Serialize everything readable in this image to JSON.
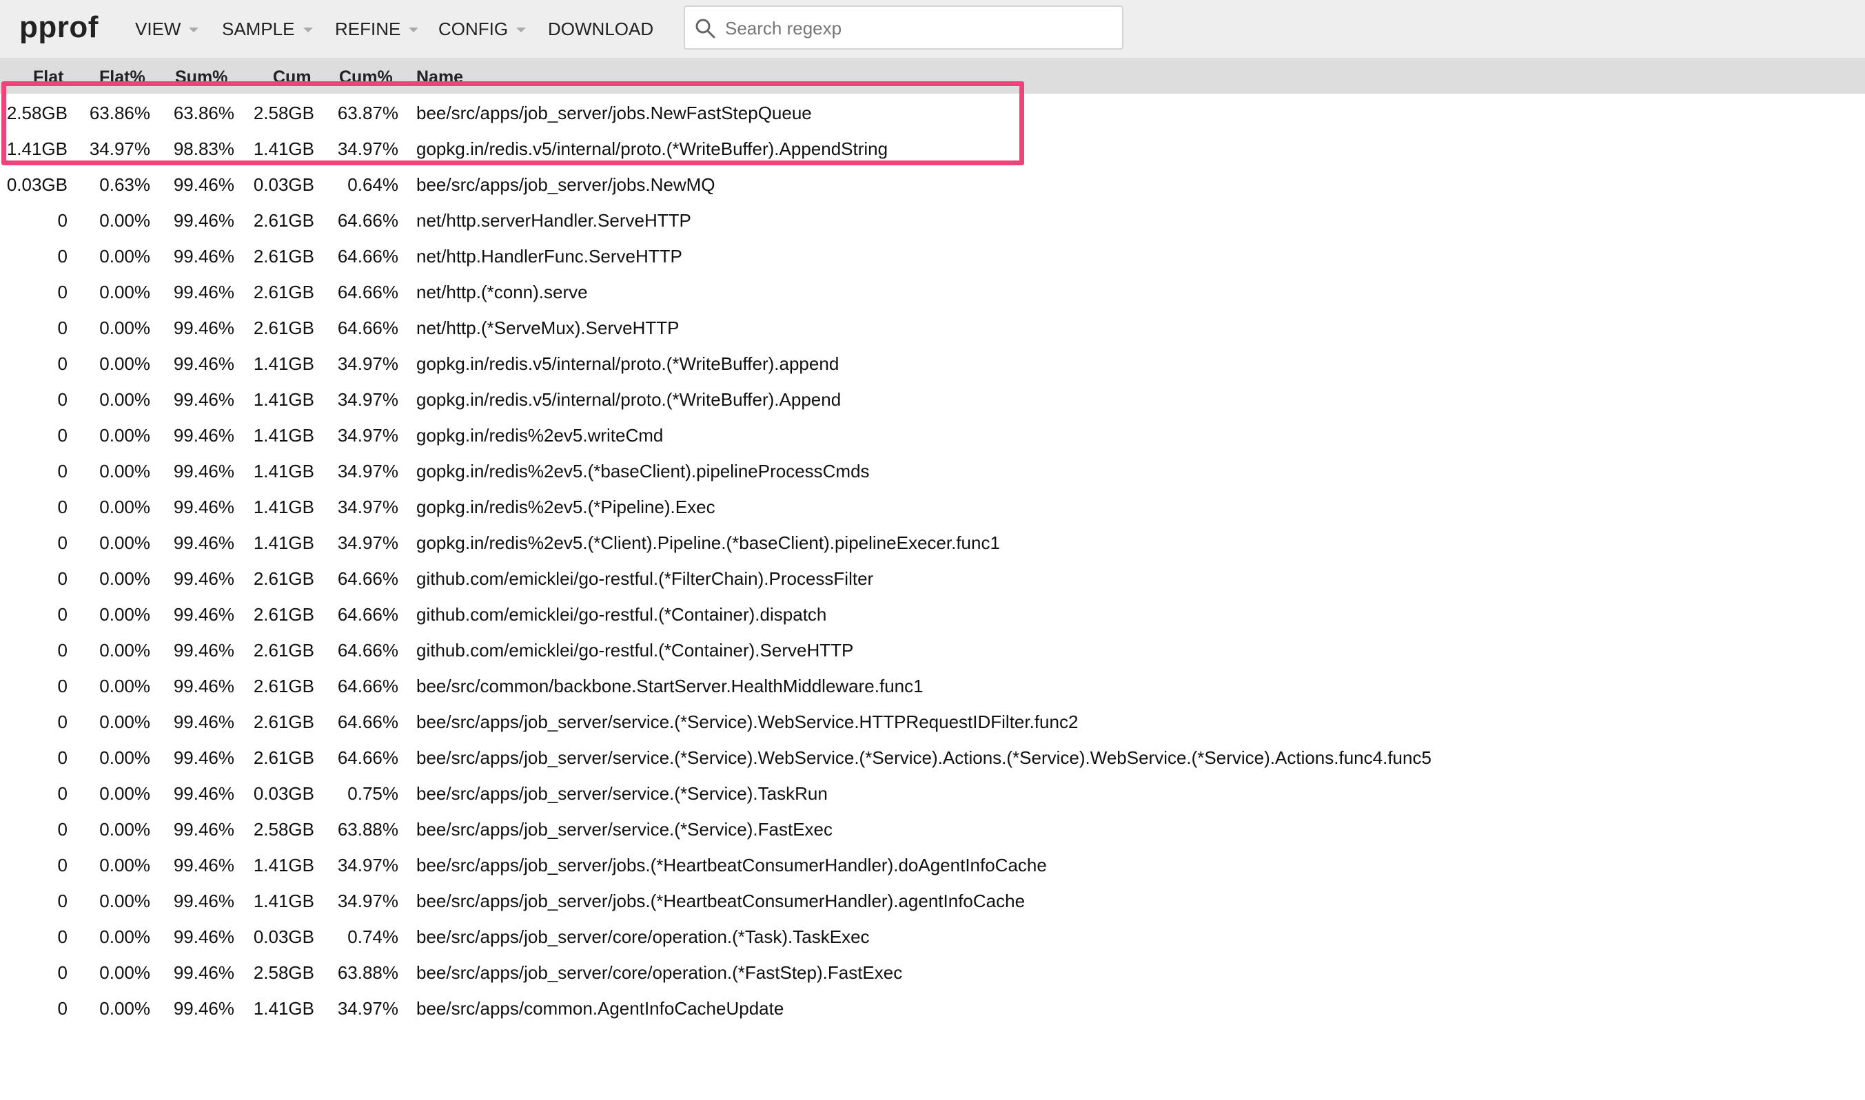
{
  "app": {
    "logo": "pprof"
  },
  "menu": {
    "items": [
      {
        "label": "VIEW",
        "has_caret": true
      },
      {
        "label": "SAMPLE",
        "has_caret": true
      },
      {
        "label": "REFINE",
        "has_caret": true
      },
      {
        "label": "CONFIG",
        "has_caret": true
      },
      {
        "label": "DOWNLOAD",
        "has_caret": false
      }
    ]
  },
  "search": {
    "placeholder": "Search regexp",
    "value": "",
    "icon": "search-icon"
  },
  "table": {
    "columns": [
      "Flat",
      "Flat%",
      "Sum%",
      "Cum",
      "Cum%",
      "Name"
    ],
    "rows": [
      {
        "flat": "2.58GB",
        "flat_pct": "63.86%",
        "sum_pct": "63.86%",
        "cum": "2.58GB",
        "cum_pct": "63.87%",
        "name": "bee/src/apps/job_server/jobs.NewFastStepQueue"
      },
      {
        "flat": "1.41GB",
        "flat_pct": "34.97%",
        "sum_pct": "98.83%",
        "cum": "1.41GB",
        "cum_pct": "34.97%",
        "name": "gopkg.in/redis.v5/internal/proto.(*WriteBuffer).AppendString"
      },
      {
        "flat": "0.03GB",
        "flat_pct": "0.63%",
        "sum_pct": "99.46%",
        "cum": "0.03GB",
        "cum_pct": "0.64%",
        "name": "bee/src/apps/job_server/jobs.NewMQ"
      },
      {
        "flat": "0",
        "flat_pct": "0.00%",
        "sum_pct": "99.46%",
        "cum": "2.61GB",
        "cum_pct": "64.66%",
        "name": "net/http.serverHandler.ServeHTTP"
      },
      {
        "flat": "0",
        "flat_pct": "0.00%",
        "sum_pct": "99.46%",
        "cum": "2.61GB",
        "cum_pct": "64.66%",
        "name": "net/http.HandlerFunc.ServeHTTP"
      },
      {
        "flat": "0",
        "flat_pct": "0.00%",
        "sum_pct": "99.46%",
        "cum": "2.61GB",
        "cum_pct": "64.66%",
        "name": "net/http.(*conn).serve"
      },
      {
        "flat": "0",
        "flat_pct": "0.00%",
        "sum_pct": "99.46%",
        "cum": "2.61GB",
        "cum_pct": "64.66%",
        "name": "net/http.(*ServeMux).ServeHTTP"
      },
      {
        "flat": "0",
        "flat_pct": "0.00%",
        "sum_pct": "99.46%",
        "cum": "1.41GB",
        "cum_pct": "34.97%",
        "name": "gopkg.in/redis.v5/internal/proto.(*WriteBuffer).append"
      },
      {
        "flat": "0",
        "flat_pct": "0.00%",
        "sum_pct": "99.46%",
        "cum": "1.41GB",
        "cum_pct": "34.97%",
        "name": "gopkg.in/redis.v5/internal/proto.(*WriteBuffer).Append"
      },
      {
        "flat": "0",
        "flat_pct": "0.00%",
        "sum_pct": "99.46%",
        "cum": "1.41GB",
        "cum_pct": "34.97%",
        "name": "gopkg.in/redis%2ev5.writeCmd"
      },
      {
        "flat": "0",
        "flat_pct": "0.00%",
        "sum_pct": "99.46%",
        "cum": "1.41GB",
        "cum_pct": "34.97%",
        "name": "gopkg.in/redis%2ev5.(*baseClient).pipelineProcessCmds"
      },
      {
        "flat": "0",
        "flat_pct": "0.00%",
        "sum_pct": "99.46%",
        "cum": "1.41GB",
        "cum_pct": "34.97%",
        "name": "gopkg.in/redis%2ev5.(*Pipeline).Exec"
      },
      {
        "flat": "0",
        "flat_pct": "0.00%",
        "sum_pct": "99.46%",
        "cum": "1.41GB",
        "cum_pct": "34.97%",
        "name": "gopkg.in/redis%2ev5.(*Client).Pipeline.(*baseClient).pipelineExecer.func1"
      },
      {
        "flat": "0",
        "flat_pct": "0.00%",
        "sum_pct": "99.46%",
        "cum": "2.61GB",
        "cum_pct": "64.66%",
        "name": "github.com/emicklei/go-restful.(*FilterChain).ProcessFilter"
      },
      {
        "flat": "0",
        "flat_pct": "0.00%",
        "sum_pct": "99.46%",
        "cum": "2.61GB",
        "cum_pct": "64.66%",
        "name": "github.com/emicklei/go-restful.(*Container).dispatch"
      },
      {
        "flat": "0",
        "flat_pct": "0.00%",
        "sum_pct": "99.46%",
        "cum": "2.61GB",
        "cum_pct": "64.66%",
        "name": "github.com/emicklei/go-restful.(*Container).ServeHTTP"
      },
      {
        "flat": "0",
        "flat_pct": "0.00%",
        "sum_pct": "99.46%",
        "cum": "2.61GB",
        "cum_pct": "64.66%",
        "name": "bee/src/common/backbone.StartServer.HealthMiddleware.func1"
      },
      {
        "flat": "0",
        "flat_pct": "0.00%",
        "sum_pct": "99.46%",
        "cum": "2.61GB",
        "cum_pct": "64.66%",
        "name": "bee/src/apps/job_server/service.(*Service).WebService.HTTPRequestIDFilter.func2"
      },
      {
        "flat": "0",
        "flat_pct": "0.00%",
        "sum_pct": "99.46%",
        "cum": "2.61GB",
        "cum_pct": "64.66%",
        "name": "bee/src/apps/job_server/service.(*Service).WebService.(*Service).Actions.(*Service).WebService.(*Service).Actions.func4.func5"
      },
      {
        "flat": "0",
        "flat_pct": "0.00%",
        "sum_pct": "99.46%",
        "cum": "0.03GB",
        "cum_pct": "0.75%",
        "name": "bee/src/apps/job_server/service.(*Service).TaskRun"
      },
      {
        "flat": "0",
        "flat_pct": "0.00%",
        "sum_pct": "99.46%",
        "cum": "2.58GB",
        "cum_pct": "63.88%",
        "name": "bee/src/apps/job_server/service.(*Service).FastExec"
      },
      {
        "flat": "0",
        "flat_pct": "0.00%",
        "sum_pct": "99.46%",
        "cum": "1.41GB",
        "cum_pct": "34.97%",
        "name": "bee/src/apps/job_server/jobs.(*HeartbeatConsumerHandler).doAgentInfoCache"
      },
      {
        "flat": "0",
        "flat_pct": "0.00%",
        "sum_pct": "99.46%",
        "cum": "1.41GB",
        "cum_pct": "34.97%",
        "name": "bee/src/apps/job_server/jobs.(*HeartbeatConsumerHandler).agentInfoCache"
      },
      {
        "flat": "0",
        "flat_pct": "0.00%",
        "sum_pct": "99.46%",
        "cum": "0.03GB",
        "cum_pct": "0.74%",
        "name": "bee/src/apps/job_server/core/operation.(*Task).TaskExec"
      },
      {
        "flat": "0",
        "flat_pct": "0.00%",
        "sum_pct": "99.46%",
        "cum": "2.58GB",
        "cum_pct": "63.88%",
        "name": "bee/src/apps/job_server/core/operation.(*FastStep).FastExec"
      },
      {
        "flat": "0",
        "flat_pct": "0.00%",
        "sum_pct": "99.46%",
        "cum": "1.41GB",
        "cum_pct": "34.97%",
        "name": "bee/src/apps/common.AgentInfoCacheUpdate"
      }
    ]
  },
  "colors": {
    "highlight_border": "#f0437a",
    "topbar_bg": "#eeeeee",
    "header_bg": "#dddddd"
  }
}
